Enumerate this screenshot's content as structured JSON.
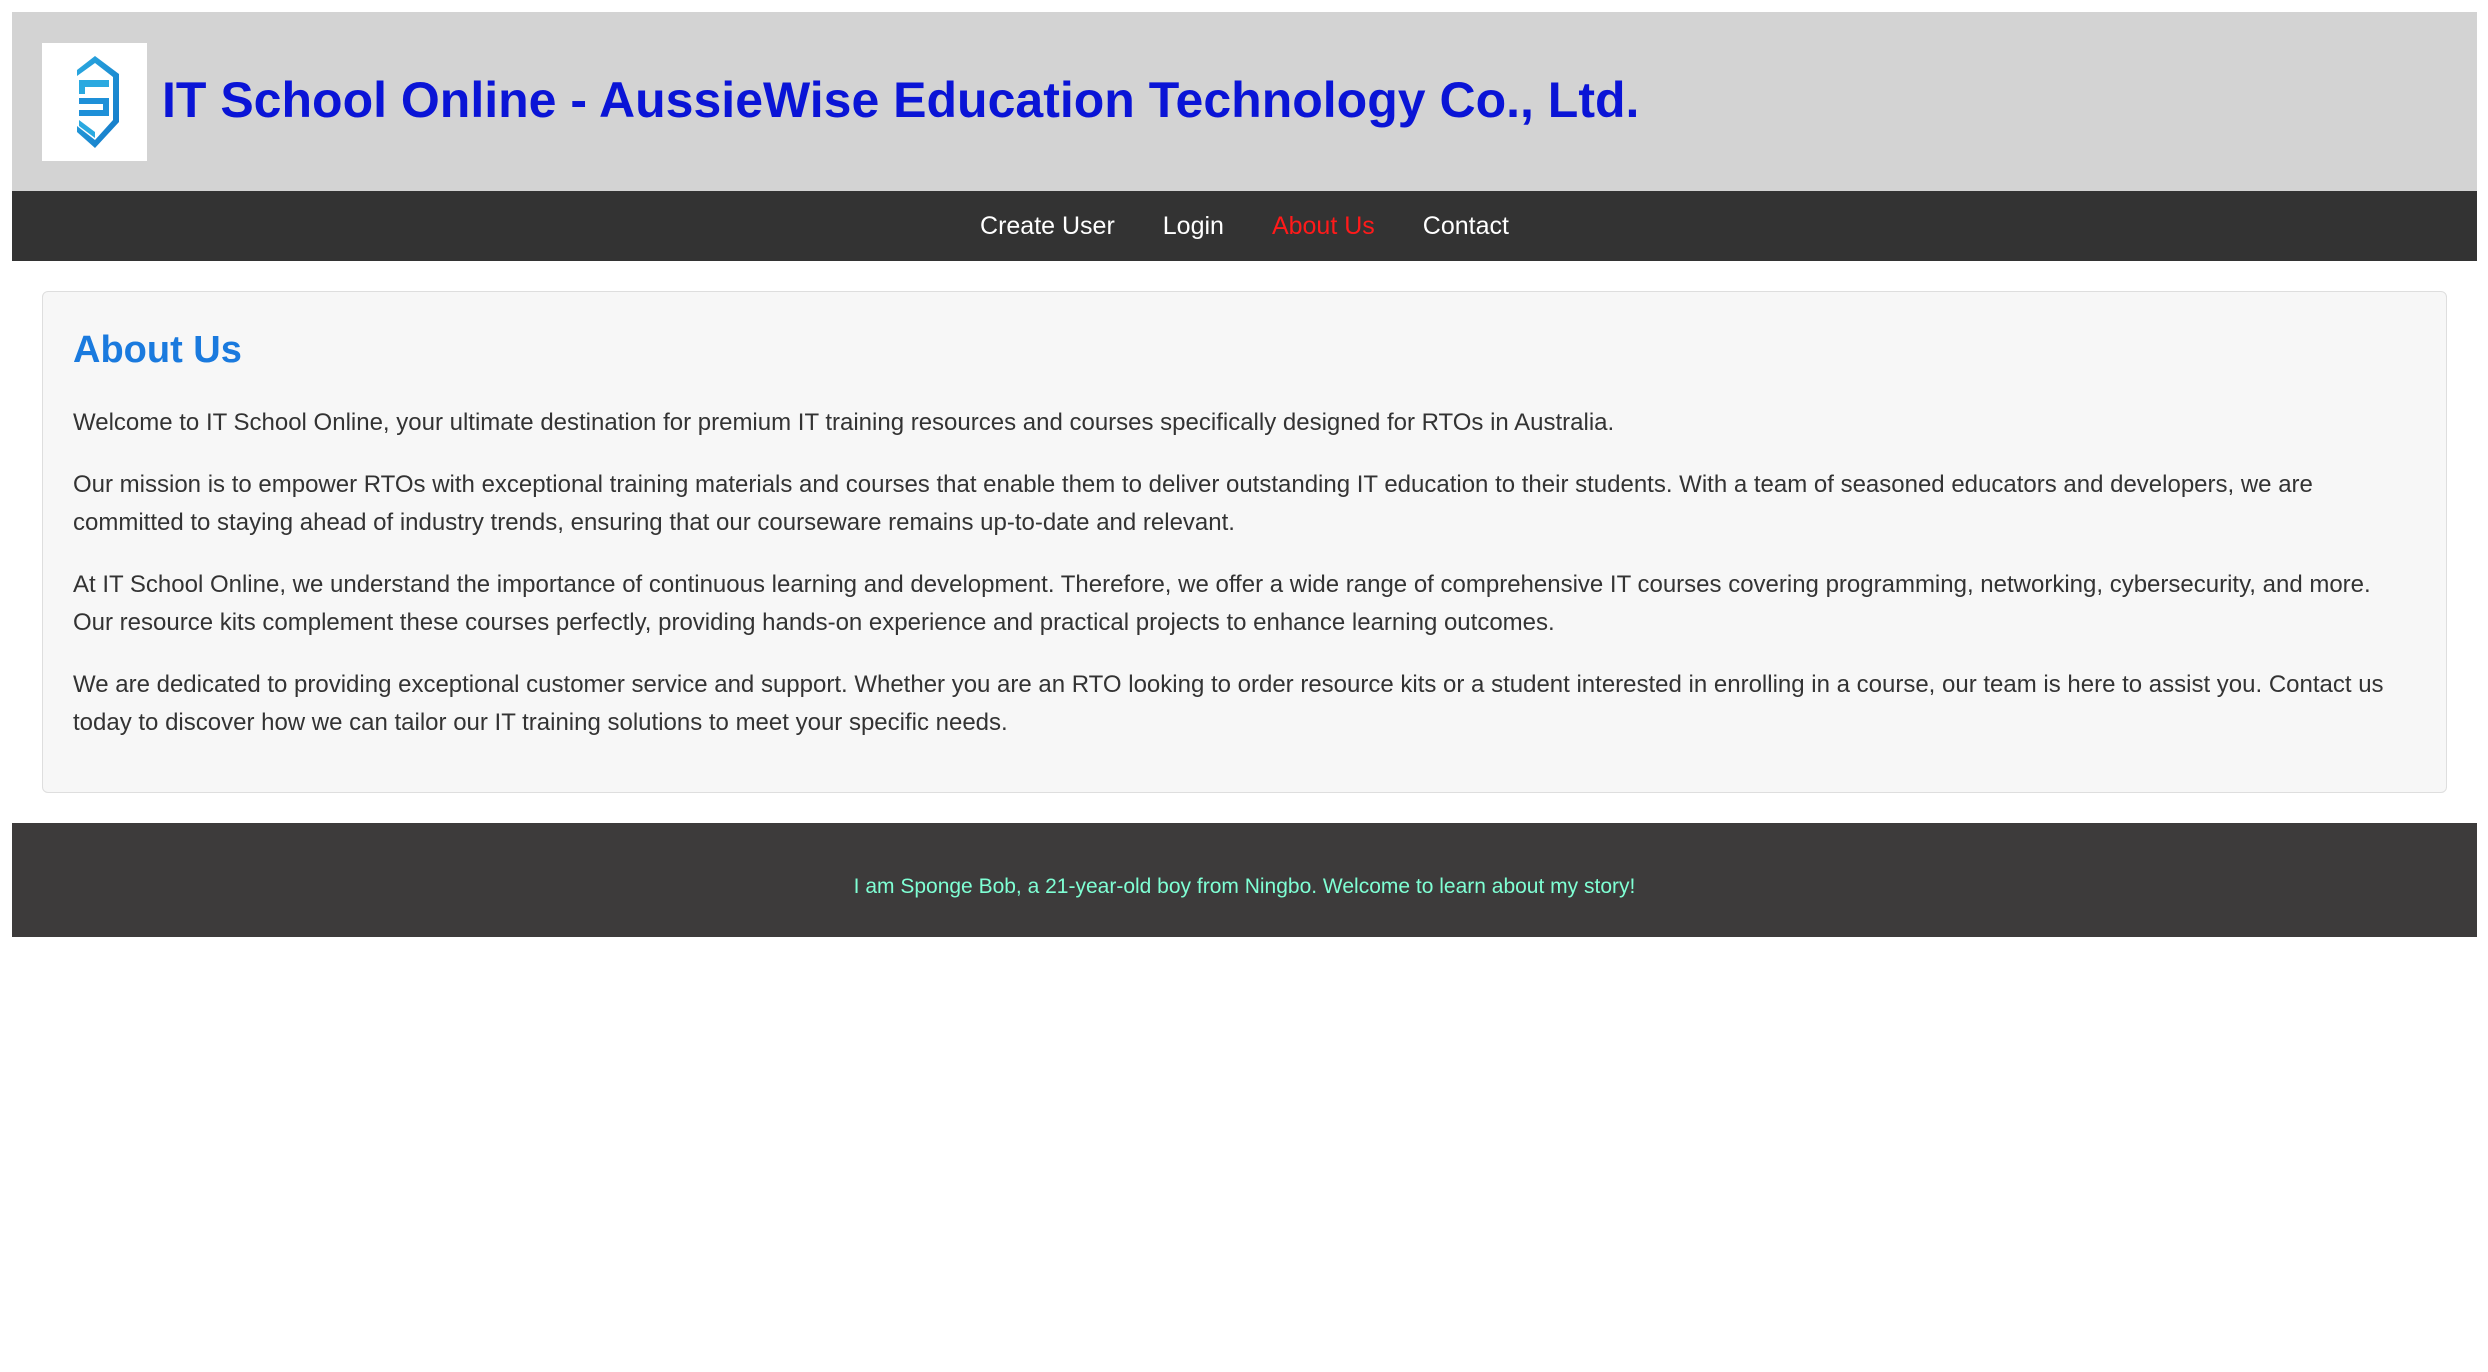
{
  "header": {
    "logo_icon": "shield-s-logo-icon",
    "title": "IT School Online - AussieWise Education Technology Co., Ltd."
  },
  "nav": {
    "items": [
      {
        "label": "Create User"
      },
      {
        "label": "Login"
      },
      {
        "label": "About Us",
        "active": true
      },
      {
        "label": "Contact"
      }
    ],
    "active_color": "#ff1a1a"
  },
  "main": {
    "heading": "About Us",
    "paragraphs": [
      "Welcome to IT School Online, your ultimate destination for premium IT training resources and courses specifically designed for RTOs in Australia.",
      "Our mission is to empower RTOs with exceptional training materials and courses that enable them to deliver outstanding IT education to their students. With a team of seasoned educators and developers, we are committed to staying ahead of industry trends, ensuring that our courseware remains up-to-date and relevant.",
      "At IT School Online, we understand the importance of continuous learning and development. Therefore, we offer a wide range of comprehensive IT courses covering programming, networking, cybersecurity, and more. Our resource kits complement these courses perfectly, providing hands-on experience and practical projects to enhance learning outcomes.",
      "We are dedicated to providing exceptional customer service and support. Whether you are an RTO looking to order resource kits or a student interested in enrolling in a course, our team is here to assist you. Contact us today to discover how we can tailor our IT training solutions to meet your specific needs."
    ]
  },
  "footer": {
    "text": "I am Sponge Bob, a 21-year-old boy from Ningbo. Welcome to learn about my story!"
  },
  "colors": {
    "header_bg": "#d3d3d3",
    "title": "#0a14d6",
    "nav_bg": "#333333",
    "heading": "#1a7ade",
    "footer_bg": "#3d3b3b",
    "footer_text": "#7fffd4"
  }
}
